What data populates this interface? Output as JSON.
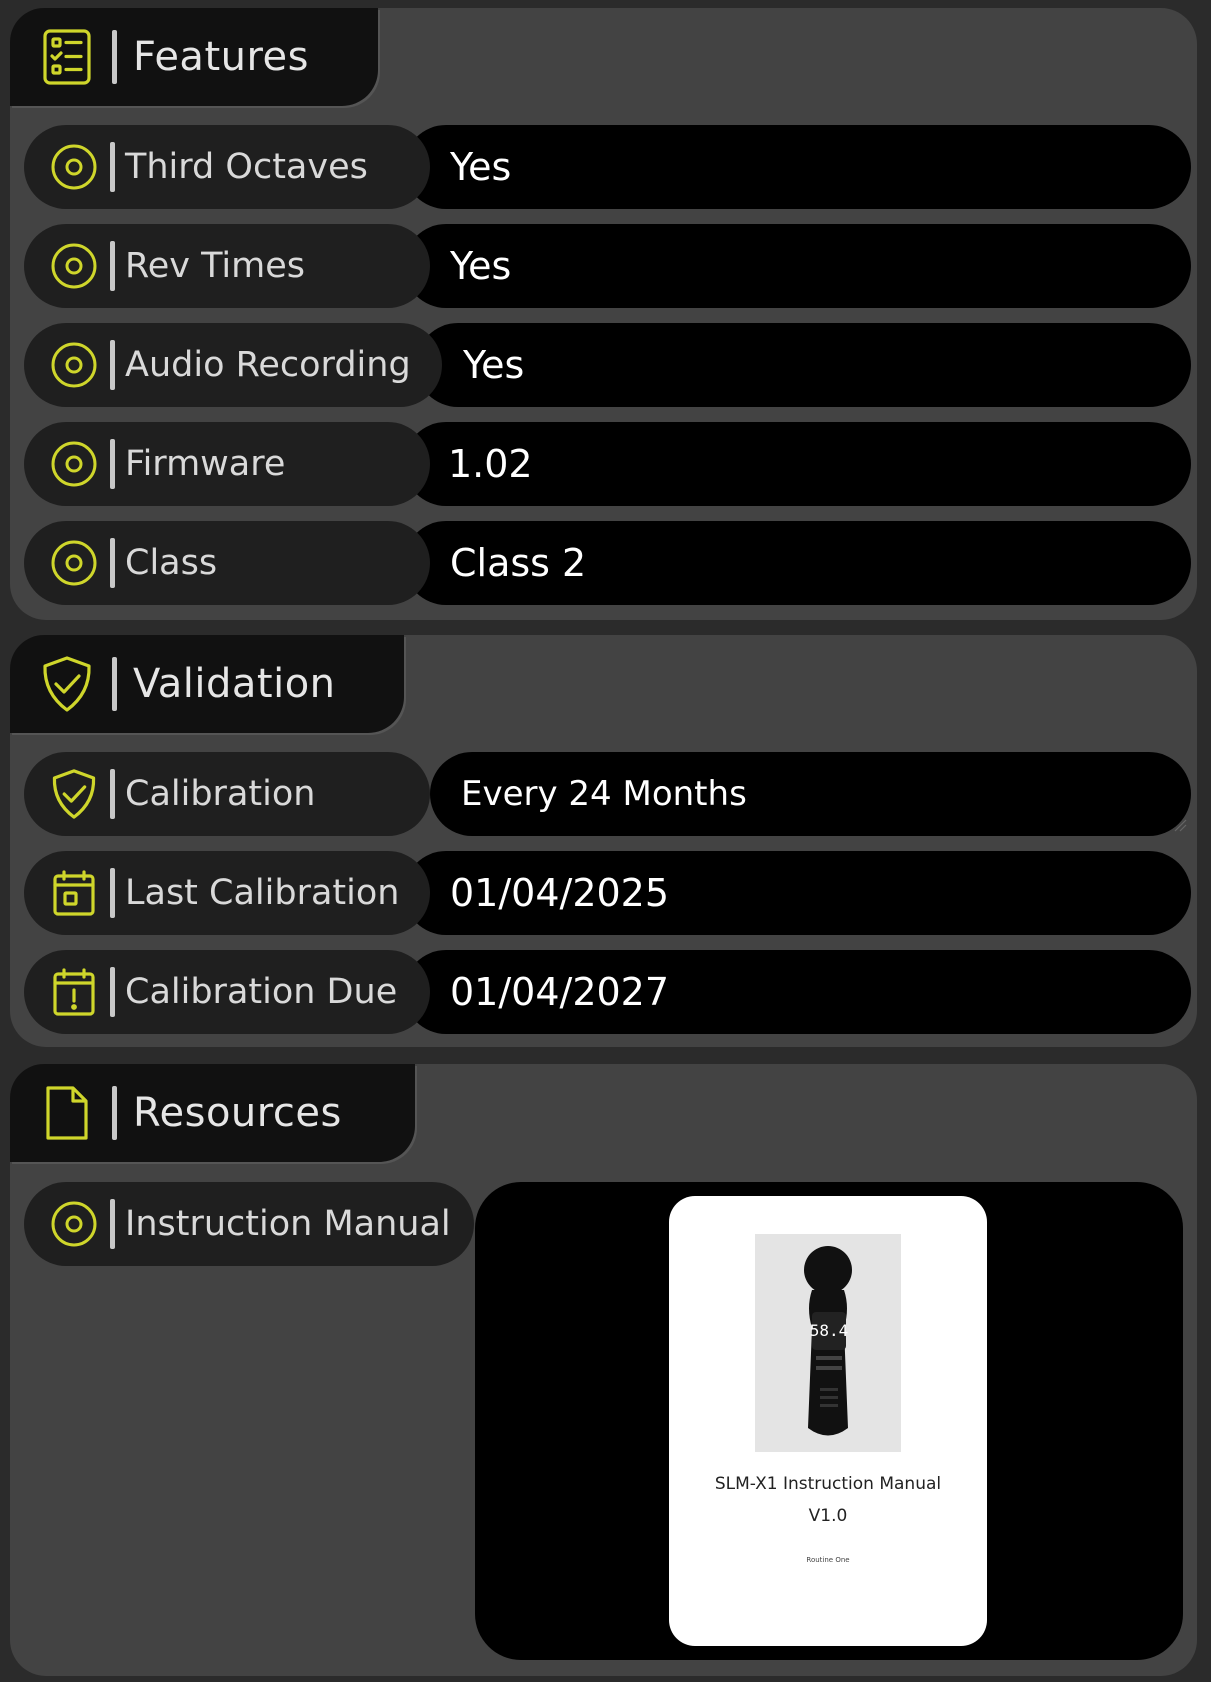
{
  "accent_color": "#cfd62b",
  "features": {
    "title": "Features",
    "icon": "checklist-icon",
    "rows": [
      {
        "label": "Third Octaves",
        "value": "Yes",
        "icon": "target-icon"
      },
      {
        "label": "Rev Times",
        "value": "Yes",
        "icon": "target-icon"
      },
      {
        "label": "Audio Recording",
        "value": "Yes",
        "icon": "target-icon"
      },
      {
        "label": "Firmware",
        "value": "1.02",
        "icon": "target-icon"
      },
      {
        "label": "Class",
        "value": "Class 2",
        "icon": "target-icon"
      }
    ]
  },
  "validation": {
    "title": "Validation",
    "icon": "shield-check-icon",
    "rows": [
      {
        "label": "Calibration",
        "value": "Every 24 Months",
        "icon": "shield-check-icon"
      },
      {
        "label": "Last Calibration",
        "value": "01/04/2025",
        "icon": "calendar-icon"
      },
      {
        "label": "Calibration Due",
        "value": "01/04/2027",
        "icon": "calendar-alert-icon"
      }
    ]
  },
  "resources": {
    "title": "Resources",
    "icon": "document-icon",
    "rows": [
      {
        "label": "Instruction Manual",
        "icon": "target-icon"
      }
    ],
    "manual": {
      "meter_reading": "58.4",
      "title": "SLM-X1 Instruction Manual",
      "version": "V1.0",
      "footer": "Routine One"
    }
  }
}
